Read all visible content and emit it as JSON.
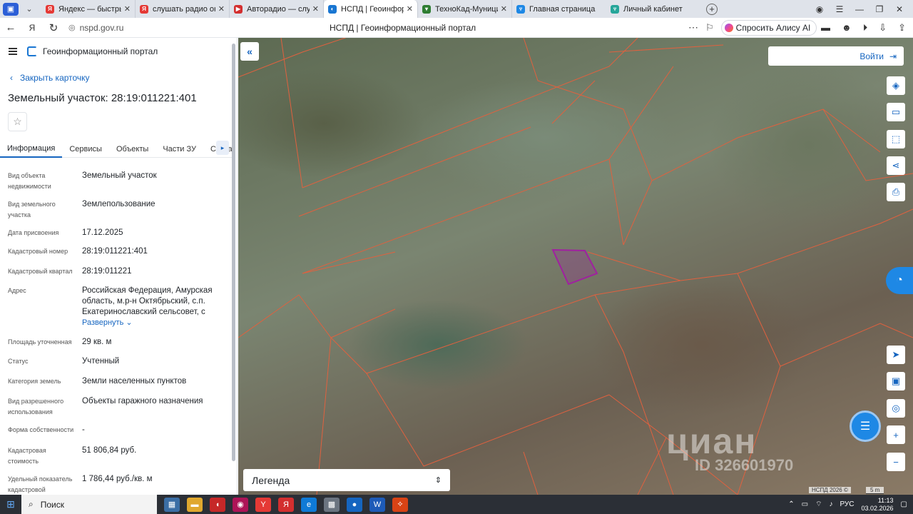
{
  "browser": {
    "tabs": [
      {
        "label": "Яндекс — быстрый поиск",
        "fav_color": "#e53935",
        "fav_glyph": "Я",
        "active": false
      },
      {
        "label": "слушать радио онлайн —",
        "fav_color": "#e53935",
        "fav_glyph": "Я",
        "active": false
      },
      {
        "label": "Авторадио — слушать",
        "fav_color": "#d32f2f",
        "fav_glyph": "▶",
        "active": false
      },
      {
        "label": "НСПД | Геоинформацион",
        "fav_color": "#1976d2",
        "fav_glyph": "◐",
        "active": true
      },
      {
        "label": "ТехноКад-Муниципалите",
        "fav_color": "#2e7d32",
        "fav_glyph": "▾",
        "active": false
      },
      {
        "label": "Главная страница",
        "fav_color": "#1e88e5",
        "fav_glyph": "▿",
        "active": false
      },
      {
        "label": "Личный кабинет",
        "fav_color": "#26a69a",
        "fav_glyph": "▿",
        "active": false
      }
    ],
    "url": "nspd.gov.ru",
    "page_title": "НСПД | Геоинформационный портал",
    "alice_label": "Спросить Алису AI"
  },
  "panel": {
    "app_title": "Геоинформационный портал",
    "back_label": "Закрыть карточку",
    "title": "Земельный участок: 28:19:011221:401",
    "tabs": [
      "Информация",
      "Сервисы",
      "Объекты",
      "Части ЗУ",
      "Соста"
    ],
    "props": [
      {
        "k": "Вид объекта недвижимости",
        "v": "Земельный участок"
      },
      {
        "k": "Вид земельного участка",
        "v": "Землепользование"
      },
      {
        "k": "Дата присвоения",
        "v": "17.12.2025"
      },
      {
        "k": "Кадастровый номер",
        "v": "28:19:011221:401"
      },
      {
        "k": "Кадастровый квартал",
        "v": "28:19:011221"
      },
      {
        "k": "Адрес",
        "v": "Российская Федерация, Амурская область, м.р-н Октябрьский, с.п. Екатеринославский сельсовет, с",
        "expand": "Развернуть"
      },
      {
        "k": "Площадь уточненная",
        "v": "29 кв. м"
      },
      {
        "k": "Статус",
        "v": "Учтенный"
      },
      {
        "k": "Категория земель",
        "v": "Земли населенных пунктов"
      },
      {
        "k": "Вид разрешенного использования",
        "v": "Объекты гаражного назначения"
      },
      {
        "k": "Форма собственности",
        "v": "-"
      },
      {
        "k": "Кадастровая стоимость",
        "v": "51 806,84 руб."
      },
      {
        "k": "Удельный показатель кадастровой",
        "v": "1 786,44 руб./кв. м"
      }
    ]
  },
  "map": {
    "login_label": "Войти",
    "legend_label": "Легенда",
    "watermark": "циан",
    "watermark_id": "ID 326601970",
    "credit": "НСПД 2026 ©",
    "scale": "5 m",
    "parcel_color": "#e0613f",
    "selected_color": "#a020a0"
  },
  "taskbar": {
    "search_label": "Поиск",
    "lang": "РУС",
    "time": "11:13",
    "date": "03.02.2026"
  }
}
